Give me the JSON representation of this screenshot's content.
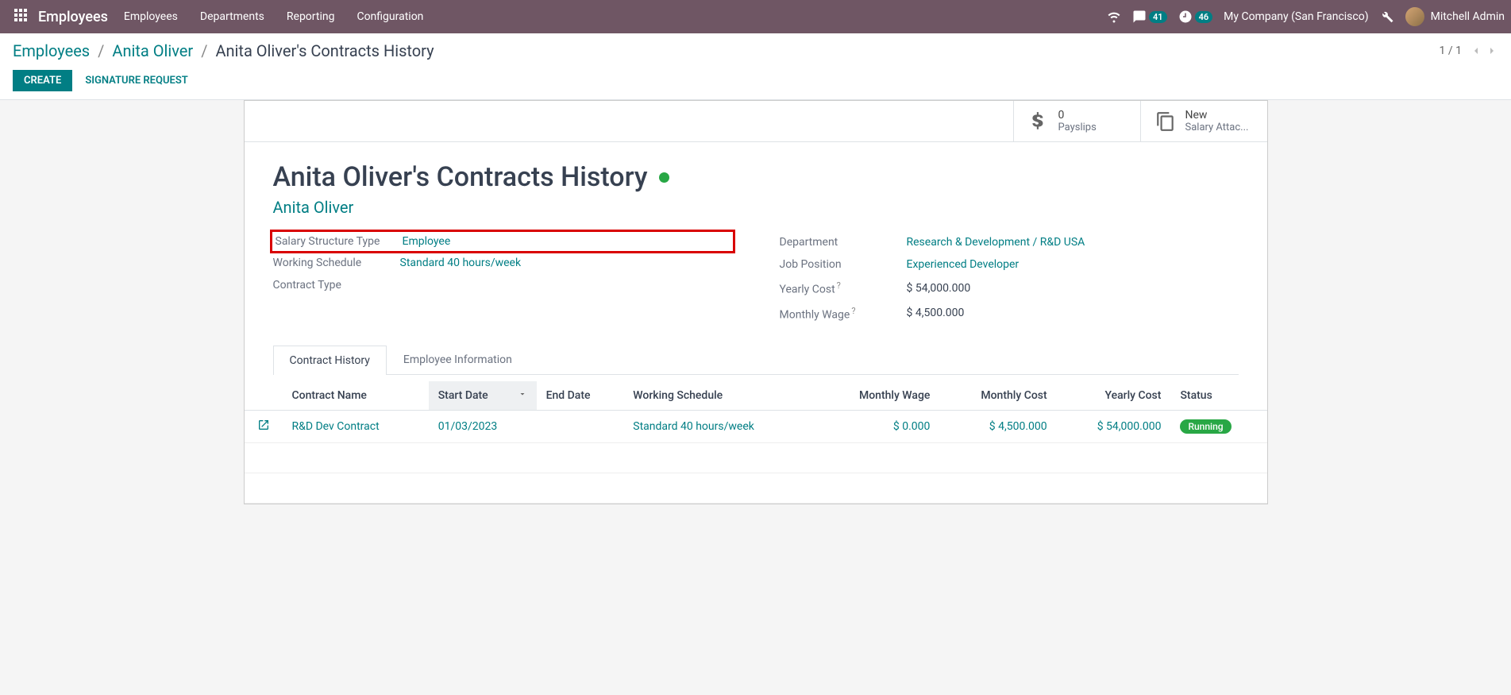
{
  "nav": {
    "brand": "Employees",
    "menu": [
      "Employees",
      "Departments",
      "Reporting",
      "Configuration"
    ],
    "chat_badge": "41",
    "clock_badge": "46",
    "company": "My Company (San Francisco)",
    "user": "Mitchell Admin"
  },
  "breadcrumb": {
    "items": [
      "Employees",
      "Anita Oliver"
    ],
    "current": "Anita Oliver's Contracts History",
    "pager": "1 / 1"
  },
  "actions": {
    "create": "CREATE",
    "sig_request": "SIGNATURE REQUEST"
  },
  "stat": {
    "payslips_val": "0",
    "payslips_lbl": "Payslips",
    "attach_val": "New",
    "attach_lbl": "Salary Attac..."
  },
  "form": {
    "title": "Anita Oliver's Contracts History",
    "employee": "Anita Oliver",
    "left": {
      "salary_struct_label": "Salary Structure Type",
      "salary_struct_value": "Employee",
      "schedule_label": "Working Schedule",
      "schedule_value": "Standard 40 hours/week",
      "contract_type_label": "Contract Type",
      "contract_type_value": ""
    },
    "right": {
      "dept_label": "Department",
      "dept_value": "Research & Development / R&D USA",
      "job_label": "Job Position",
      "job_value": "Experienced Developer",
      "yearly_label": "Yearly Cost",
      "yearly_value": "$ 54,000.000",
      "monthly_label": "Monthly Wage",
      "monthly_value": "$ 4,500.000"
    }
  },
  "tabs": {
    "history": "Contract History",
    "info": "Employee Information"
  },
  "table": {
    "headers": {
      "name": "Contract Name",
      "start": "Start Date",
      "end": "End Date",
      "schedule": "Working Schedule",
      "mwage": "Monthly Wage",
      "mcost": "Monthly Cost",
      "ycost": "Yearly Cost",
      "status": "Status"
    },
    "rows": [
      {
        "name": "R&D Dev Contract",
        "start": "01/03/2023",
        "end": "",
        "schedule": "Standard 40 hours/week",
        "mwage": "$ 0.000",
        "mcost": "$ 4,500.000",
        "ycost": "$ 54,000.000",
        "status": "Running"
      }
    ]
  }
}
